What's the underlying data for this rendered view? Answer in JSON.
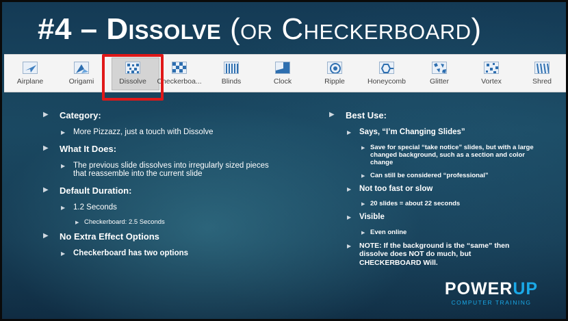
{
  "title": {
    "main": "#4 – Dissolve",
    "sub": "(or Checkerboard)"
  },
  "ribbon": {
    "items": [
      {
        "label": "Airplane",
        "icon": "airplane-icon"
      },
      {
        "label": "Origami",
        "icon": "origami-icon"
      },
      {
        "label": "Dissolve",
        "icon": "dissolve-icon",
        "selected": true
      },
      {
        "label": "Checkerboa...",
        "icon": "checkerboard-icon"
      },
      {
        "label": "Blinds",
        "icon": "blinds-icon"
      },
      {
        "label": "Clock",
        "icon": "clock-icon"
      },
      {
        "label": "Ripple",
        "icon": "ripple-icon"
      },
      {
        "label": "Honeycomb",
        "icon": "honeycomb-icon"
      },
      {
        "label": "Glitter",
        "icon": "glitter-icon"
      },
      {
        "label": "Vortex",
        "icon": "vortex-icon"
      },
      {
        "label": "Shred",
        "icon": "shred-icon"
      }
    ],
    "highlight_color": "#e01818"
  },
  "left": {
    "category": {
      "heading": "Category:",
      "items": [
        "More Pizzazz, just a touch with Dissolve"
      ]
    },
    "what": {
      "heading": "What It Does:",
      "items": [
        "The previous slide dissolves into irregularly sized pieces that reassemble into the current slide"
      ]
    },
    "duration": {
      "heading": "Default Duration:",
      "item": "1.2 Seconds",
      "sub": "Checkerboard: 2.5 Seconds"
    },
    "extra": {
      "heading": "No Extra Effect Options",
      "item": "Checkerboard has two options"
    }
  },
  "right": {
    "best": {
      "heading": "Best Use:",
      "says": "Says, “I’m Changing Slides”",
      "says_subs": [
        "Save for special “take notice” slides, but with a large changed background, such as a section and color change",
        "Can still be considered “professional”"
      ],
      "speed": "Not too fast or slow",
      "speed_sub": "20 slides = about 22 seconds",
      "visible": "Visible",
      "visible_sub": "Even online",
      "note": "NOTE: If the background is the “same” then dissolve does NOT do much, but CHECKERBOARD Will."
    }
  },
  "logo": {
    "word_a": "POWER",
    "word_b": "UP",
    "tagline": "COMPUTER TRAINING"
  },
  "colors": {
    "accent": "#1aa9e8",
    "background": "#1b4a63"
  }
}
